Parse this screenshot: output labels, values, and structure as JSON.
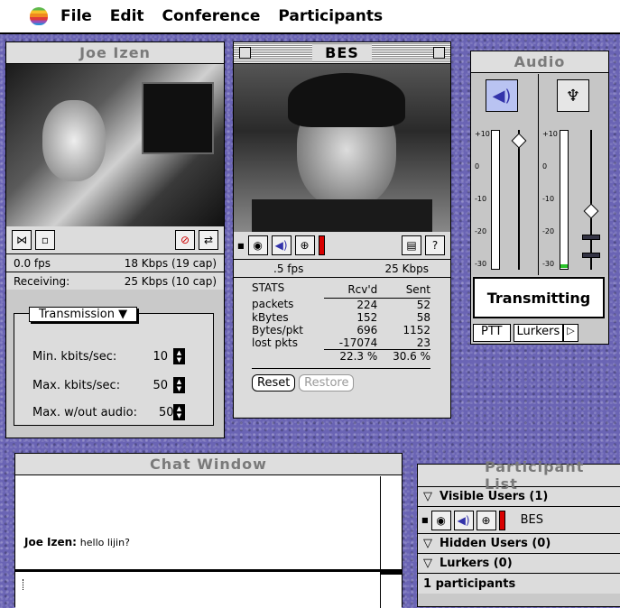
{
  "menubar": {
    "items": [
      "File",
      "Edit",
      "Conference",
      "Participants"
    ]
  },
  "joe": {
    "title": "Joe Izen",
    "fps": "0.0 fps",
    "kbps": "18 Kbps",
    "cap": "(19 cap)",
    "receiving_label": "Receiving:",
    "receiving_kbps": "25 Kbps",
    "receiving_cap": "(10 cap)",
    "transmission": {
      "dropdown": "Transmission",
      "min_label": "Min. kbits/sec:",
      "min_value": "10",
      "max_label": "Max. kbits/sec:",
      "max_value": "50",
      "maxwo_label": "Max. w/out audio:",
      "maxwo_value": "50"
    }
  },
  "bes": {
    "title": "BES",
    "fps": ".5 fps",
    "kbps": "25 Kbps",
    "stats": {
      "headers": [
        "STATS",
        "Rcv'd",
        "Sent"
      ],
      "rows": [
        [
          "packets",
          "224",
          "52"
        ],
        [
          "kBytes",
          "152",
          "58"
        ],
        [
          "Bytes/pkt",
          "696",
          "1152"
        ],
        [
          "lost pkts",
          "-17074",
          "23"
        ],
        [
          "",
          "22.3 %",
          "30.6 %"
        ]
      ]
    },
    "reset": "Reset",
    "restore": "Restore"
  },
  "audio": {
    "title": "Audio",
    "scale": [
      "+10",
      "0",
      "-10",
      "-20",
      "-30"
    ],
    "status": "Transmitting",
    "tabs": [
      "PTT",
      "Lurkers"
    ]
  },
  "chat": {
    "title": "Chat Window",
    "message_sender": "Joe Izen",
    "message_sep": ":",
    "message_text": "hello lijin?"
  },
  "participants": {
    "title": "Participant List",
    "visible": "Visible Users (1)",
    "user": "BES",
    "hidden": "Hidden Users (0)",
    "lurkers": "Lurkers (0)",
    "count": "1 participants"
  }
}
